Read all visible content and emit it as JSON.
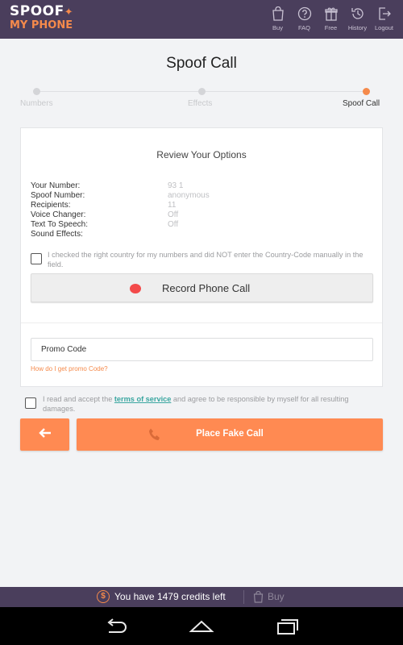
{
  "app": {
    "logo_line1": "SPOOF",
    "logo_line2": "MY PHONE"
  },
  "nav": [
    {
      "label": "Buy",
      "icon": "shopping-bag-icon"
    },
    {
      "label": "FAQ",
      "icon": "question-icon"
    },
    {
      "label": "Free",
      "icon": "gift-icon"
    },
    {
      "label": "History",
      "icon": "history-icon"
    },
    {
      "label": "Logout",
      "icon": "logout-icon"
    }
  ],
  "page": {
    "title": "Spoof Call"
  },
  "steps": [
    {
      "label": "Numbers",
      "active": false
    },
    {
      "label": "Effects",
      "active": false
    },
    {
      "label": "Spoof Call",
      "active": true
    }
  ],
  "review": {
    "title": "Review Your Options",
    "options": [
      {
        "key": "Your Number:",
        "value": "93 1"
      },
      {
        "key": "Spoof Number:",
        "value": "anonymous"
      },
      {
        "key": "Recipients:",
        "value": "11"
      },
      {
        "key": "Voice Changer:",
        "value": "Off"
      },
      {
        "key": "Text To Speech:",
        "value": "Off"
      },
      {
        "key": "Sound Effects:",
        "value": ""
      }
    ],
    "country_check_label": "I checked the right country for my numbers and did NOT enter the Country-Code manually in the field.",
    "country_checked": false,
    "record_label": "Record Phone Call"
  },
  "promo": {
    "placeholder": "Promo Code",
    "help_link": "How do I get promo Code?"
  },
  "terms": {
    "text_before": "I read and accept the ",
    "link": "terms of service",
    "text_after": " and agree to be responsible by myself for all resulting damages.",
    "checked": false
  },
  "actions": {
    "back_icon": "arrow-left-icon",
    "place_call_label": "Place Fake Call",
    "place_call_icon": "phone-icon"
  },
  "credits": {
    "text": "You have 1479 credits left",
    "buy_label": "Buy",
    "coin_symbol": "$"
  },
  "colors": {
    "header_bg": "#4a3e5c",
    "accent": "#ff8a52",
    "link": "#3aa6a0",
    "record_dot": "#f34a4a"
  }
}
